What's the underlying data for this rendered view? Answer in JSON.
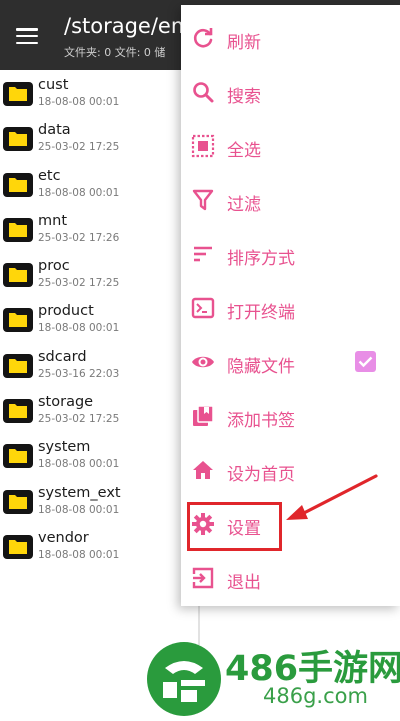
{
  "header": {
    "path_title": "/storage/emu",
    "path_sub": "文件夹: 0  文件: 0  储"
  },
  "files": [
    {
      "name": "cust",
      "date": "18-08-08 00:01"
    },
    {
      "name": "data",
      "date": "25-03-02 17:25"
    },
    {
      "name": "etc",
      "date": "18-08-08 00:01"
    },
    {
      "name": "mnt",
      "date": "25-03-02 17:26"
    },
    {
      "name": "proc",
      "date": "25-03-02 17:25"
    },
    {
      "name": "product",
      "date": "18-08-08 00:01"
    },
    {
      "name": "sdcard",
      "date": "25-03-16 22:03"
    },
    {
      "name": "storage",
      "date": "25-03-02 17:25"
    },
    {
      "name": "system",
      "date": "18-08-08 00:01"
    },
    {
      "name": "system_ext",
      "date": "18-08-08 00:01"
    },
    {
      "name": "vendor",
      "date": "18-08-08 00:01"
    }
  ],
  "menu": {
    "items": [
      {
        "label": "刷新",
        "icon": "refresh-icon"
      },
      {
        "label": "搜索",
        "icon": "search-icon"
      },
      {
        "label": "全选",
        "icon": "select-all-icon"
      },
      {
        "label": "过滤",
        "icon": "filter-icon"
      },
      {
        "label": "排序方式",
        "icon": "sort-icon"
      },
      {
        "label": "打开终端",
        "icon": "terminal-icon"
      },
      {
        "label": "隐藏文件",
        "icon": "eye-icon",
        "checked": true
      },
      {
        "label": "添加书签",
        "icon": "bookmark-icon"
      },
      {
        "label": "设为首页",
        "icon": "home-icon"
      },
      {
        "label": "设置",
        "icon": "gear-icon"
      },
      {
        "label": "退出",
        "icon": "exit-icon"
      }
    ]
  },
  "colors": {
    "accent": "#e8528f",
    "appbar": "#2e2e2e",
    "folder": "#ffd60a",
    "highlight": "#e0262b",
    "watermark": "#2a9b3d"
  },
  "watermark": {
    "title": "486手游网",
    "domain": "486g.com"
  }
}
